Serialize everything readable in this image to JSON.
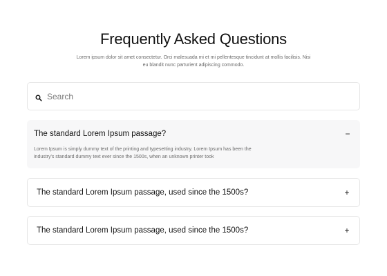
{
  "header": {
    "title": "Frequently Asked Questions",
    "subtitle": "Lorem ipsum dolor sit amet consectetur. Orci malesuada mi et mi pellentesque tincidunt at mollis facilisis. Nisi eu blandit nunc parturient adipiscing commodo."
  },
  "search": {
    "placeholder": "Search",
    "value": ""
  },
  "faq": {
    "items": [
      {
        "question": "The standard Lorem Ipsum passage?",
        "answer": "Lorem Ipsum is simply dummy text of the printing and typesetting industry. Lorem Ipsum has been the industry's standard dummy text ever since the 1500s, when an unknown printer took",
        "expanded": true,
        "toggle": "−"
      },
      {
        "question": "The standard Lorem Ipsum passage, used since the 1500s?",
        "expanded": false,
        "toggle": "+"
      },
      {
        "question": "The standard Lorem Ipsum passage, used since the 1500s?",
        "expanded": false,
        "toggle": "+"
      }
    ]
  },
  "icons": {
    "search": "search-icon",
    "expanded": "minus-icon",
    "collapsed": "plus-icon"
  }
}
